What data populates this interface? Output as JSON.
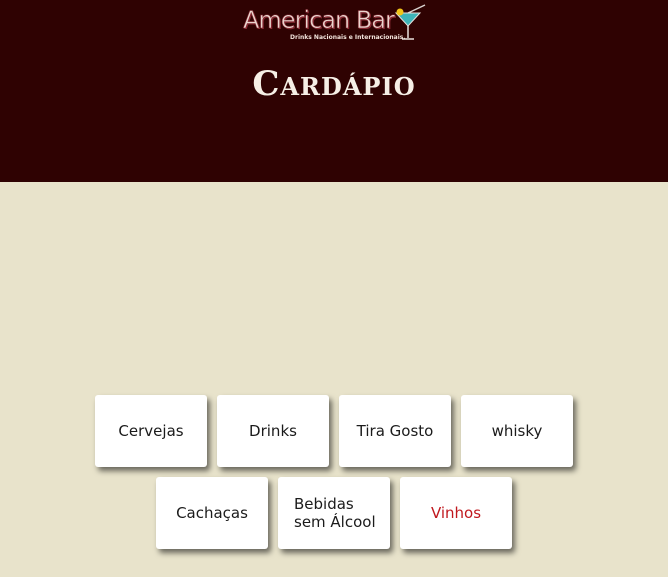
{
  "header": {
    "logo_text": "American Bar",
    "logo_subtitle": "Drinks Nacionais e Internacionais.",
    "title": "Cardápio"
  },
  "menu": {
    "items": [
      {
        "label": "Cervejas"
      },
      {
        "label": "Drinks"
      },
      {
        "label": "Tira Gosto"
      },
      {
        "label": "whisky"
      },
      {
        "label": "Cachaças"
      },
      {
        "label_line1": "Bebidas",
        "label_line2": "sem Álcool"
      },
      {
        "label": "Vinhos",
        "active": true
      }
    ]
  },
  "colors": {
    "header_bg": "#2f0202",
    "page_bg": "#e8e3cb",
    "active_text": "#c0181e"
  }
}
